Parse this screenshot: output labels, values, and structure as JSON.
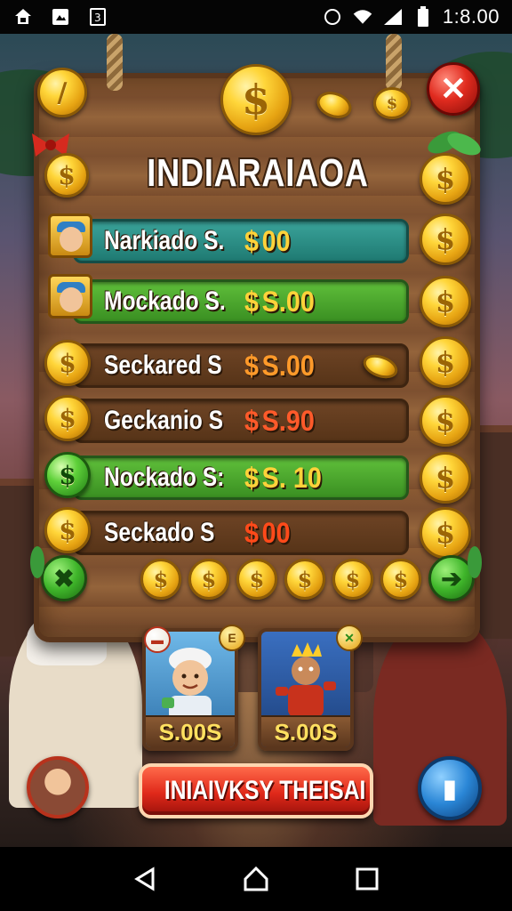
{
  "status_bar": {
    "time": "1:8.00",
    "left_icons": [
      "game-notification-icon",
      "photo-notification-icon",
      "app-notification-icon"
    ],
    "right_icons": [
      "circle-status-icon",
      "wifi-icon",
      "signal-icon",
      "battery-icon"
    ]
  },
  "board": {
    "title": "INDIARAIAOA",
    "close_icon": "close-icon"
  },
  "leaderboard": [
    {
      "name": "Narkiado S.",
      "value": "00",
      "style": "teal",
      "icon": "avatar",
      "value_color": "#ffd23a"
    },
    {
      "name": "Mockado S.",
      "value": "S.00",
      "style": "green",
      "icon": "avatar",
      "value_color": "#ffd23a"
    },
    {
      "name": "Seckared S",
      "value": "S.00",
      "style": "wood",
      "icon": "coin",
      "value_color": "#ff9a2a"
    },
    {
      "name": "Geckanio S",
      "value": "S.90",
      "style": "wood",
      "icon": "coin",
      "value_color": "#ff5a2a"
    },
    {
      "name": "Nockado S:",
      "value": "S. 10",
      "style": "green",
      "icon": "green-coin",
      "value_color": "#ffd23a"
    },
    {
      "name": "Seckado S",
      "value": "00",
      "style": "wood",
      "icon": "coin",
      "value_color": "#ff4a1a"
    }
  ],
  "leaderboard_dollar": "$",
  "coin_symbol": "$",
  "shop": {
    "cards": [
      {
        "price": "S.00S",
        "badge": "",
        "art": "chef-character"
      },
      {
        "price": "S.00S",
        "badge": "",
        "art": "monkey-king-character"
      }
    ]
  },
  "cta_label": "INIAIVKSY THEISAI",
  "colors": {
    "accent_gold": "#ffd63a",
    "close_red": "#e02b1f",
    "cta_red": "#e0291a",
    "row_green": "#5fbf3a",
    "row_teal": "#3aa39a",
    "wood": "#7d5030"
  }
}
